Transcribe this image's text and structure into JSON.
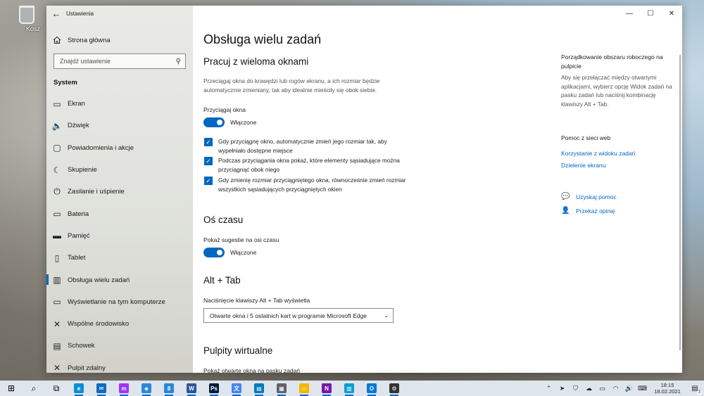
{
  "desktop": {
    "recycle_label": "Kosz"
  },
  "window": {
    "app_title": "Ustawienia",
    "controls": {
      "minimize": "—",
      "maximize": "☐",
      "close": "✕"
    }
  },
  "sidebar": {
    "home_label": "Strona główna",
    "search_placeholder": "Znajdź ustawienie",
    "section": "System",
    "items": [
      {
        "label": "Ekran",
        "icon": "display-icon"
      },
      {
        "label": "Dźwięk",
        "icon": "speaker-icon"
      },
      {
        "label": "Powiadomienia i akcje",
        "icon": "notification-icon"
      },
      {
        "label": "Skupienie",
        "icon": "moon-icon"
      },
      {
        "label": "Zasilanie i uśpienie",
        "icon": "power-icon"
      },
      {
        "label": "Bateria",
        "icon": "battery-icon"
      },
      {
        "label": "Pamięć",
        "icon": "storage-icon"
      },
      {
        "label": "Tablet",
        "icon": "tablet-icon"
      },
      {
        "label": "Obsługa wielu zadań",
        "icon": "multitask-icon",
        "active": true
      },
      {
        "label": "Wyświetlanie na tym komputerze",
        "icon": "project-icon"
      },
      {
        "label": "Wspólne środowisko",
        "icon": "shared-icon"
      },
      {
        "label": "Schowek",
        "icon": "clipboard-icon"
      },
      {
        "label": "Pulpit zdalny",
        "icon": "remote-icon"
      }
    ]
  },
  "main": {
    "title": "Obsługa wielu zadań",
    "snap": {
      "heading": "Pracuj z wieloma oknami",
      "description": "Przeciągaj okna do krawędzi lub rogów ekranu, a ich rozmiar będzie automatycznie zmieniany, tak aby idealnie mieściły się obok siebie.",
      "toggle_label": "Przyciągaj okna",
      "toggle_state": "Włączone",
      "checks": [
        {
          "text": "Gdy przyciągnę okno, automatycznie zmień jego rozmiar tak, aby wypełniało dostępne miejsce",
          "checked": true
        },
        {
          "text": "Podczas przyciągania okna pokaż, które elementy sąsiadujące można przyciągnąć obok niego",
          "checked": true
        },
        {
          "text": "Gdy zmienię rozmiar przyciągniętego okna, równocześnie zmień rozmiar wszystkich sąsiadujących przyciągniętych okien",
          "checked": true
        }
      ]
    },
    "timeline": {
      "heading": "Oś czasu",
      "toggle_label": "Pokaż sugestie na osi czasu",
      "toggle_state": "Włączone"
    },
    "alttab": {
      "heading": "Alt + Tab",
      "label": "Naciśnięcie klawiszy Alt + Tab wyświetla",
      "selected": "Otwarte okna i 5 ostatnich kart w programie Microsoft Edge"
    },
    "virtual": {
      "heading": "Pulpity wirtualne",
      "label": "Pokaż otwarte okna na pasku zadań"
    }
  },
  "right": {
    "arrange_title": "Porządkowanie obszaru roboczego na pulpicie",
    "arrange_desc": "Aby się przełączać między otwartymi aplikacjami, wybierz opcję Widok zadań na pasku zadań lub naciśnij kombinację klawiszy Alt + Tab.",
    "web_help_title": "Pomoc z sieci web",
    "links": [
      "Korzystanie z widoku zadań",
      "Dzielenie ekranu"
    ],
    "get_help": "Uzyskaj pomoc",
    "feedback": "Przekaż opinię"
  },
  "taskbar": {
    "apps": [
      {
        "name": "start",
        "glyph": "⊞",
        "color": "#000000"
      },
      {
        "name": "search",
        "glyph": "⌕",
        "color": "#000000"
      },
      {
        "name": "task-view",
        "glyph": "⧉",
        "color": "#000000"
      },
      {
        "name": "edge",
        "glyph": "e",
        "color": "#0c8fd6"
      },
      {
        "name": "mail",
        "glyph": "✉",
        "color": "#0f6cbd"
      },
      {
        "name": "messenger",
        "glyph": "m",
        "color": "#a033ff"
      },
      {
        "name": "app-shield",
        "glyph": "◈",
        "color": "#2b88d8"
      },
      {
        "name": "files",
        "glyph": "8",
        "color": "#2b88d8"
      },
      {
        "name": "word",
        "glyph": "W",
        "color": "#2b579a"
      },
      {
        "name": "photoshop",
        "glyph": "Ps",
        "color": "#001e36"
      },
      {
        "name": "translator",
        "glyph": "文",
        "color": "#4285f4"
      },
      {
        "name": "trello",
        "glyph": "▤",
        "color": "#0079bf"
      },
      {
        "name": "calculator",
        "glyph": "▦",
        "color": "#5f6368"
      },
      {
        "name": "explorer",
        "glyph": "▭",
        "color": "#f2b600"
      },
      {
        "name": "onenote",
        "glyph": "N",
        "color": "#7719aa"
      },
      {
        "name": "azure",
        "glyph": "▥",
        "color": "#0b9dd5"
      },
      {
        "name": "outlook",
        "glyph": "O",
        "color": "#0078d4"
      },
      {
        "name": "settings",
        "glyph": "⚙",
        "color": "#333333"
      }
    ],
    "time": "18:15",
    "date": "18.02.2021",
    "notifications": "3"
  }
}
